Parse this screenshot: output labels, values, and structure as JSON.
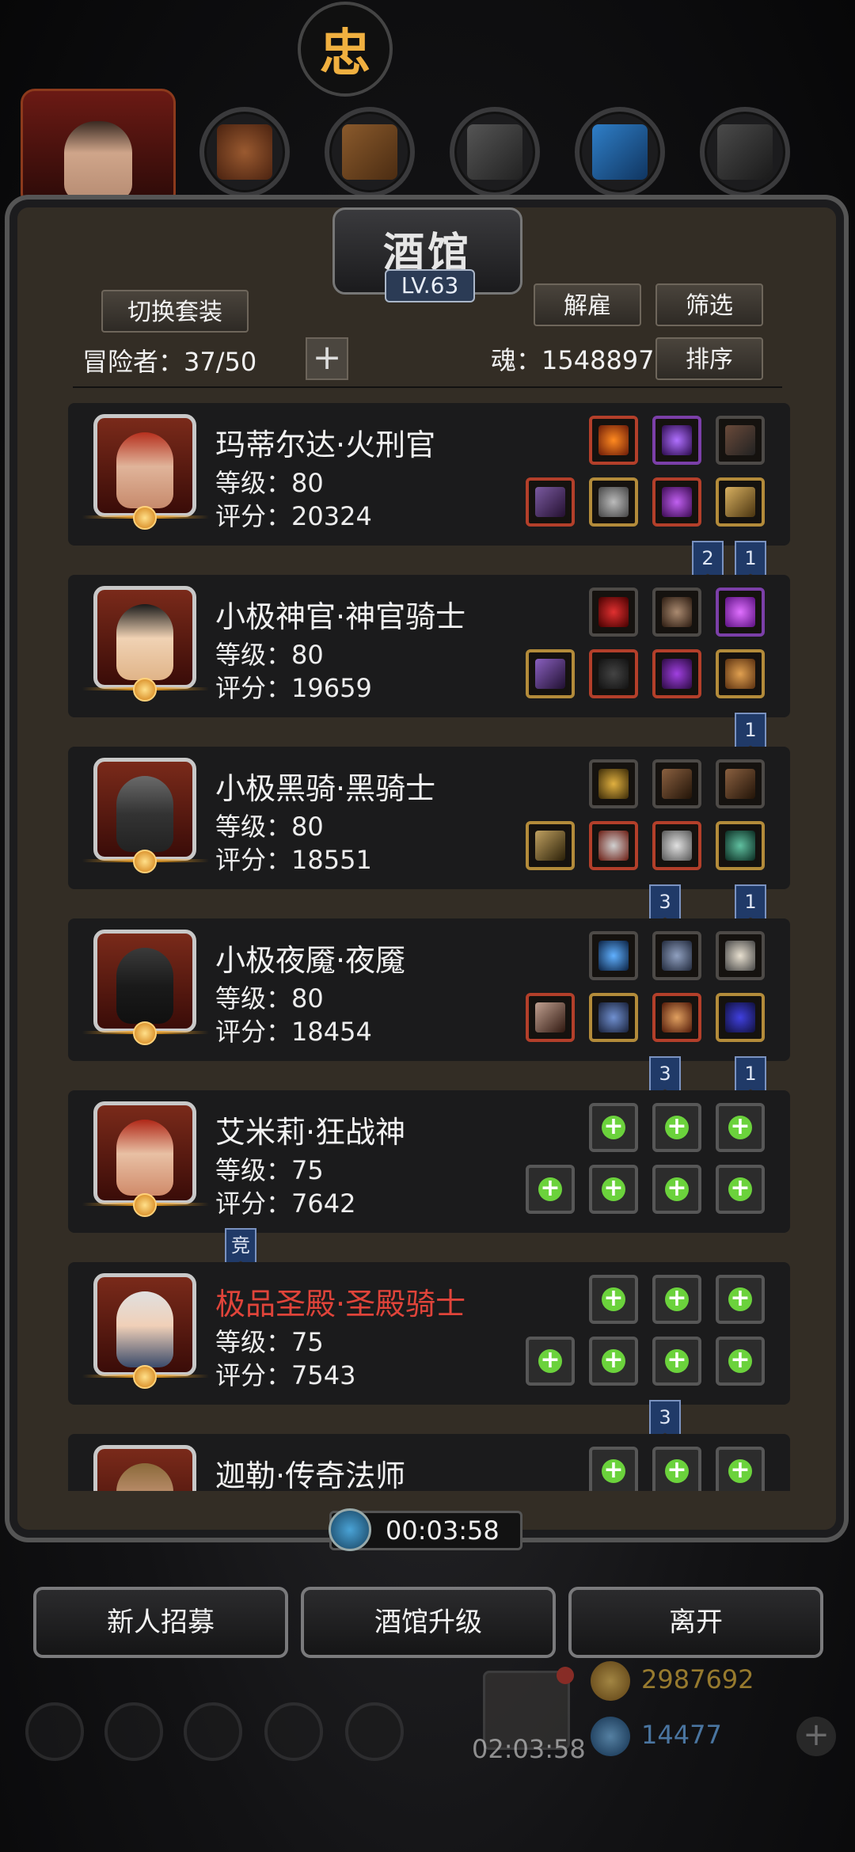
{
  "top": {
    "badge_glyph": "忠"
  },
  "panel": {
    "title": "酒馆",
    "level": "LV.63",
    "switch_set_label": "切换套装",
    "dismiss_label": "解雇",
    "filter_label": "筛选",
    "sort_label": "排序",
    "adventurers_text": "冒险者：37/50",
    "soul_text": "魂：1548897"
  },
  "heroes": [
    {
      "name": "玛蒂尔达·火刑官",
      "level": "等级：80",
      "score": "评分：20324",
      "highlight": false,
      "tags": [
        "2",
        "1"
      ]
    },
    {
      "name": "小极神官·神官骑士",
      "level": "等级：80",
      "score": "评分：19659",
      "highlight": false,
      "tags": [
        "1"
      ]
    },
    {
      "name": "小极黑骑·黑骑士",
      "level": "等级：80",
      "score": "评分：18551",
      "highlight": false,
      "tags": [
        "3",
        "1"
      ]
    },
    {
      "name": "小极夜魇·夜魇",
      "level": "等级：80",
      "score": "评分：18454",
      "highlight": false,
      "tags": [
        "3",
        "1"
      ]
    },
    {
      "name": "艾米莉·狂战神",
      "level": "等级：75",
      "score": "评分：7642",
      "highlight": false,
      "tags": [
        "竞"
      ]
    },
    {
      "name": "极品圣殿·圣殿骑士",
      "level": "等级：75",
      "score": "评分：7543",
      "highlight": true,
      "tags": [
        "3"
      ]
    },
    {
      "name": "迦勒·传奇法师",
      "level": "",
      "score": "",
      "highlight": false,
      "tags": []
    }
  ],
  "timer": {
    "value": "00:03:58"
  },
  "bottom": {
    "recruit_label": "新人招募",
    "upgrade_label": "酒馆升级",
    "leave_label": "离开",
    "gift_timer": "02:03:58",
    "gold": "2987692",
    "gems": "14477"
  },
  "colors": {
    "accent_gold": "#f0a020",
    "highlight_red": "#e0443a",
    "tag_blue": "#203a68",
    "plus_green": "#6bd23c"
  }
}
